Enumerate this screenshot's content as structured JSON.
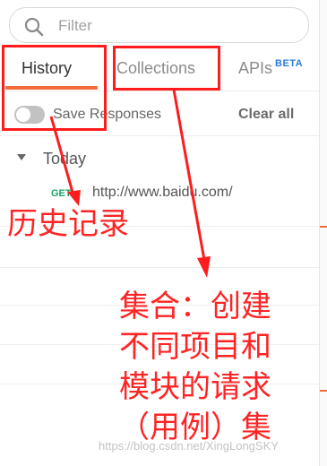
{
  "filter": {
    "placeholder": "Filter"
  },
  "tabs": [
    {
      "label": "History",
      "active": true
    },
    {
      "label": "Collections",
      "active": false
    },
    {
      "label": "APIs",
      "badge": "BETA",
      "active": false
    }
  ],
  "toolbar": {
    "save_responses_label": "Save Responses",
    "save_responses_enabled": false,
    "clear_all_label": "Clear all"
  },
  "history": {
    "groups": [
      {
        "label": "Today",
        "expanded": true,
        "items": [
          {
            "method": "GET",
            "url": "http://www.baidu.com/"
          }
        ]
      }
    ]
  },
  "annotations": {
    "history_note": "历史记录",
    "collections_note_lines": [
      "集合：创建",
      "不同项目和",
      "模块的请求",
      "（用例）集"
    ]
  },
  "watermark": "https://blog.csdn.net/XingLongSKY",
  "colors": {
    "accent": "#f26b3a",
    "annotation": "#ff1c1c",
    "beta": "#2a7ce0",
    "method_get": "#1aa36a"
  }
}
